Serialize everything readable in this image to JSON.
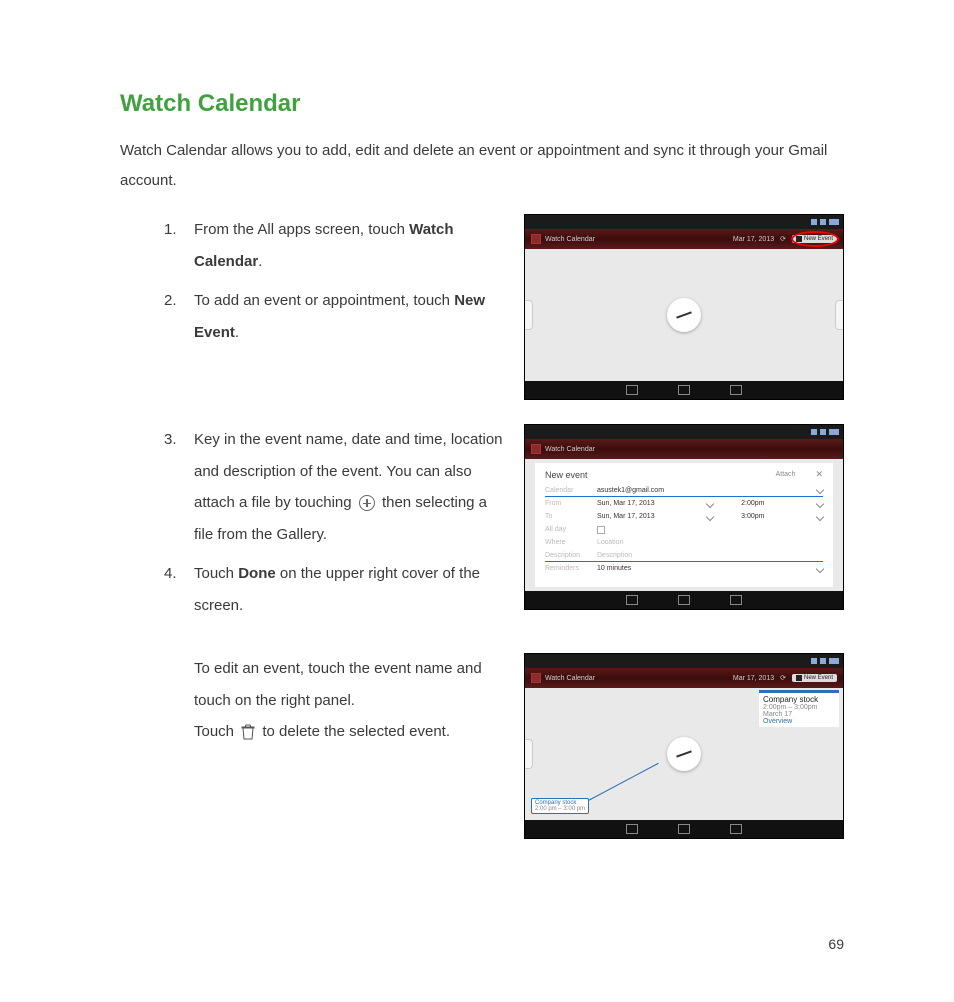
{
  "title": "Watch Calendar",
  "intro": "Watch Calendar allows you to add, edit and delete an event or appointment and sync it through your Gmail account.",
  "steps": {
    "s1": {
      "num": "1.",
      "pre": "From the All apps screen, touch ",
      "bold": "Watch Calendar",
      "post": "."
    },
    "s2": {
      "num": "2.",
      "pre": "To add an event or appointment, touch ",
      "bold": "New Event",
      "post": "."
    },
    "s3": {
      "num": "3.",
      "pre": "Key in the event name, date and time, location and description of the event. You can also attach a file by touching ",
      "post": " then selecting a file from the Gallery."
    },
    "s4": {
      "num": "4.",
      "pre": "Touch ",
      "bold": "Done",
      "post": " on the upper right cover of the screen."
    }
  },
  "edit_note": {
    "l1": "To edit an event, touch the event name and touch on the right panel.",
    "l2a": "Touch ",
    "l2b": " to delete the selected event."
  },
  "page_number": "69",
  "shots": {
    "titlebar_app": "Watch Calendar",
    "titlebar_date": "Mar 17, 2013",
    "new_event_btn": "New Event",
    "form": {
      "title": "New event",
      "attach": "Attach",
      "calendar_label": "Calendar",
      "calendar_val": "asustek1@gmail.com",
      "from_label": "From",
      "from_date": "Sun, Mar 17, 2013",
      "from_time": "2:00pm",
      "to_label": "To",
      "to_date": "Sun, Mar 17, 2013",
      "to_time": "3:00pm",
      "allday_label": "All day",
      "where_label": "Where",
      "where_ph": "Location",
      "desc_label": "Description",
      "desc_ph": "Description",
      "rem_label": "Reminders",
      "rem_val": "10 minutes"
    },
    "event": {
      "name": "Company stock",
      "sub": "2:00pm – 3:00pm  March 17",
      "link": "Overview",
      "tag": "Company stock",
      "tag_sub": "2:00 pm – 3:00 pm"
    }
  }
}
